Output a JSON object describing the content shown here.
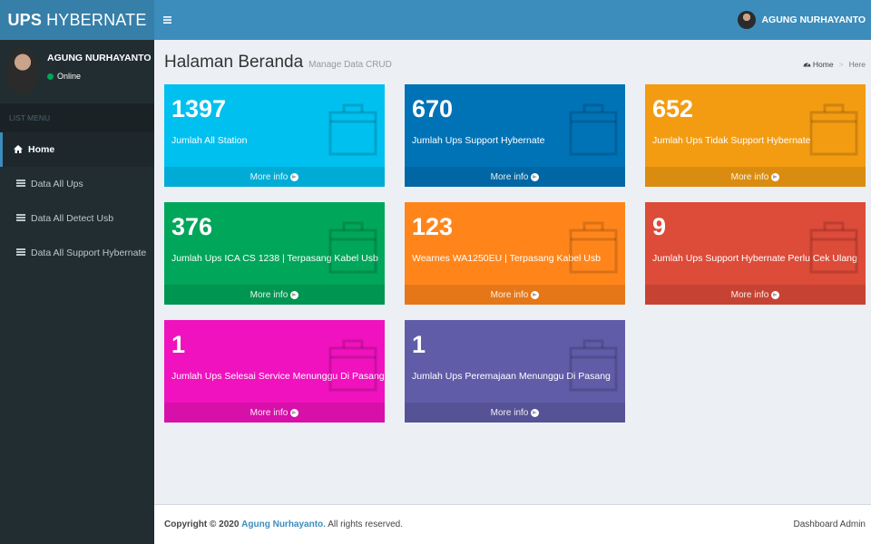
{
  "app": {
    "logo_bold": "UPS",
    "logo_rest": "HYBERNATE"
  },
  "user": {
    "name": "AGUNG NURHAYANTO",
    "status": "Online"
  },
  "sidebar": {
    "header": "LIST MENU",
    "items": [
      {
        "label": "Home",
        "icon": "home-icon"
      },
      {
        "label": "Data All Ups",
        "icon": "table-icon"
      },
      {
        "label": "Data All Detect Usb",
        "icon": "table-icon"
      },
      {
        "label": "Data All Support Hybernate",
        "icon": "table-icon"
      }
    ]
  },
  "header": {
    "toggle_icon": "hamburger-icon",
    "title": "Halaman Beranda",
    "subtitle": "Manage Data CRUD"
  },
  "breadcrumb": {
    "home": "Home",
    "here": "Here"
  },
  "boxes": [
    {
      "count": "1397",
      "label": "Jumlah All Station",
      "more": "More info",
      "color": "#00c0ef"
    },
    {
      "count": "670",
      "label": "Jumlah Ups Support Hybernate",
      "more": "More info",
      "color": "#0073b7"
    },
    {
      "count": "652",
      "label": "Jumlah Ups Tidak Support Hybernate",
      "more": "More info",
      "color": "#f39c12"
    },
    {
      "count": "376",
      "label": "Jumlah Ups ICA CS 1238 | Terpasang Kabel Usb",
      "more": "More info",
      "color": "#00a65a"
    },
    {
      "count": "123",
      "label": "Wearnes WA1250EU | Terpasang Kabel Usb",
      "more": "More info",
      "color": "#ff851b"
    },
    {
      "count": "9",
      "label": "Jumlah Ups Support Hybernate Perlu Cek Ulang",
      "more": "More info",
      "color": "#dd4b39"
    },
    {
      "count": "1",
      "label": "Jumlah Ups Selesai Service Menunggu Di Pasang",
      "more": "More info",
      "color": "#f012be"
    },
    {
      "count": "1",
      "label": "Jumlah Ups Peremajaan Menunggu Di Pasang",
      "more": "More info",
      "color": "#605ca8"
    }
  ],
  "footer": {
    "copyright": "Copyright © 2020",
    "author": "Agung Nurhayanto.",
    "rights": "All rights reserved.",
    "right_text": "Dashboard Admin"
  }
}
